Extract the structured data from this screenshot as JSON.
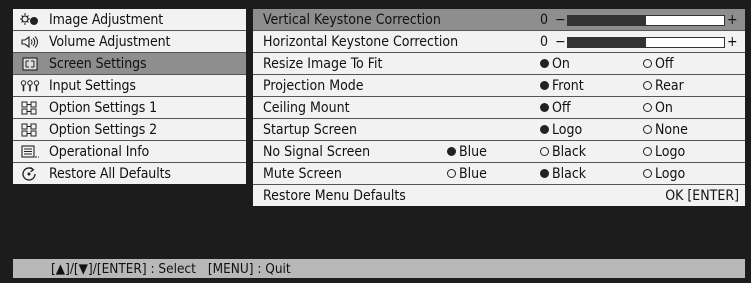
{
  "sidebar": {
    "items": [
      {
        "label": "Image Adjustment",
        "icon": "image-adjustment-icon"
      },
      {
        "label": "Volume Adjustment",
        "icon": "speaker-icon"
      },
      {
        "label": "Screen Settings",
        "icon": "screen-icon",
        "selected": true
      },
      {
        "label": "Input Settings",
        "icon": "input-icon"
      },
      {
        "label": "Option Settings 1",
        "icon": "options-icon"
      },
      {
        "label": "Option Settings 2",
        "icon": "options-icon"
      },
      {
        "label": "Operational Info",
        "icon": "info-icon"
      },
      {
        "label": "Restore All Defaults",
        "icon": "restore-icon"
      }
    ]
  },
  "main": {
    "vertical_keystone": {
      "label": "Vertical Keystone Correction",
      "value": "0",
      "minus": "−",
      "plus": "+",
      "level": 0.5
    },
    "horizontal_keystone": {
      "label": "Horizontal Keystone Correction",
      "value": "0",
      "minus": "−",
      "plus": "+",
      "level": 0.5
    },
    "resize_image": {
      "label": "Resize Image To Fit",
      "options": [
        "On",
        "Off"
      ],
      "selected": "On"
    },
    "projection_mode": {
      "label": "Projection Mode",
      "options": [
        "Front",
        "Rear"
      ],
      "selected": "Front"
    },
    "ceiling_mount": {
      "label": "Ceiling Mount",
      "options": [
        "Off",
        "On"
      ],
      "selected": "Off"
    },
    "startup_screen": {
      "label": "Startup Screen",
      "options": [
        "Logo",
        "None"
      ],
      "selected": "Logo"
    },
    "no_signal_screen": {
      "label": "No Signal Screen",
      "options": [
        "Blue",
        "Black",
        "Logo"
      ],
      "selected": "Blue"
    },
    "mute_screen": {
      "label": "Mute Screen",
      "options": [
        "Blue",
        "Black",
        "Logo"
      ],
      "selected": "Black"
    },
    "restore_menu_defaults": {
      "label": "Restore Menu Defaults",
      "action": "OK [ENTER]"
    }
  },
  "footer": {
    "select_hint": "[▲]/[▼]/[ENTER] : Select",
    "quit_hint": "[MENU] : Quit"
  }
}
